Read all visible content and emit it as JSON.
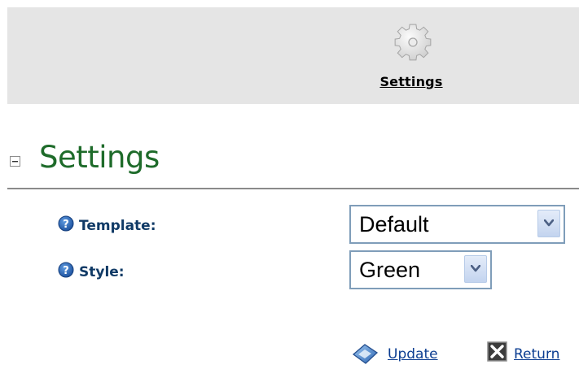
{
  "toolbar": {
    "settings_icon": "gear-icon",
    "settings_label": "Settings"
  },
  "section": {
    "collapse_icon": "collapse-minus-icon",
    "title": "Settings",
    "title_color": "#1e6b2a"
  },
  "form": {
    "fields": [
      {
        "label": "Template:",
        "help_icon": "help-icon",
        "selected_value": "Default"
      },
      {
        "label": "Style:",
        "help_icon": "help-icon",
        "selected_value": "Green"
      }
    ]
  },
  "actions": {
    "update": {
      "label": "Update",
      "icon": "update-icon"
    },
    "return": {
      "label": "Return",
      "icon": "close-icon"
    }
  },
  "colors": {
    "label_text": "#103a66",
    "link": "#0b3d91",
    "toolbar_bg": "#e5e5e5",
    "select_border": "#7f9db9"
  }
}
